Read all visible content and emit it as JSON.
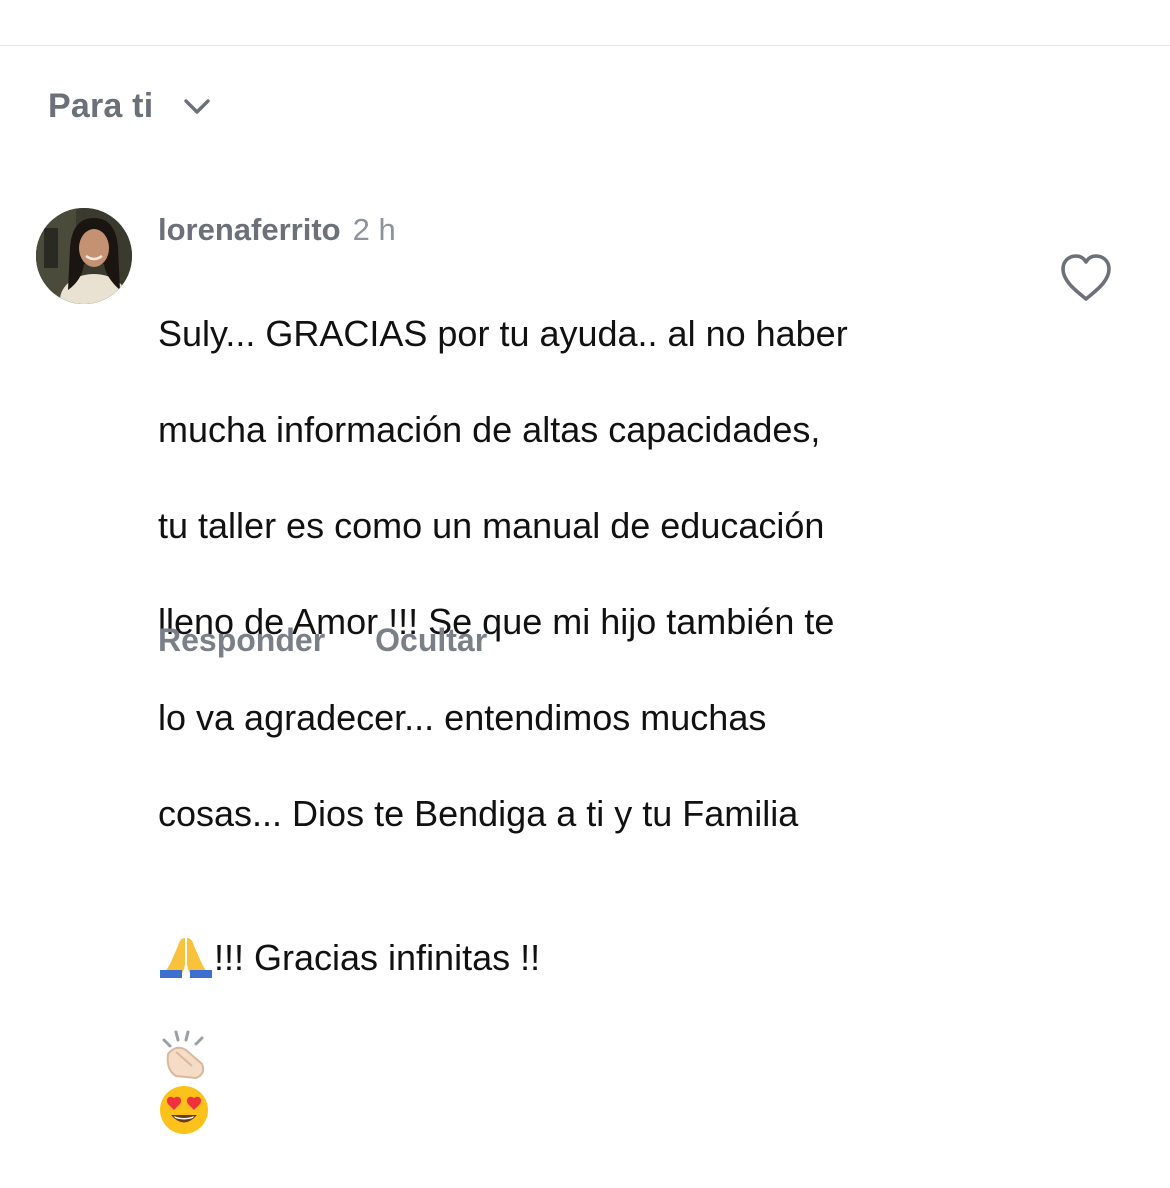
{
  "sort": {
    "label": "Para ti",
    "icon": "chevron-down-icon"
  },
  "comment": {
    "username": "lorenaferrito",
    "time": "2 h",
    "lines": [
      "Suly... GRACIAS por tu ayuda.. al no haber",
      "mucha información de altas capacidades,",
      "tu taller es como un manual de educación",
      "lleno de Amor !!! Se que mi hijo  también te",
      "lo va agradecer... entendimos muchas",
      "cosas... Dios te Bendiga a ti y tu Familia"
    ],
    "last_line_text": "!!! Gracias infinitas !!",
    "emojis": [
      "praying-hands-icon",
      "clapping-hands-icon",
      "heart-eyes-face-icon"
    ],
    "like_icon": "heart-outline-icon"
  },
  "actions": {
    "reply": "Responder",
    "hide": "Ocultar"
  },
  "colors": {
    "muted_text": "#6b7079",
    "body_text": "#111111",
    "divider": "#e6e6e6"
  }
}
